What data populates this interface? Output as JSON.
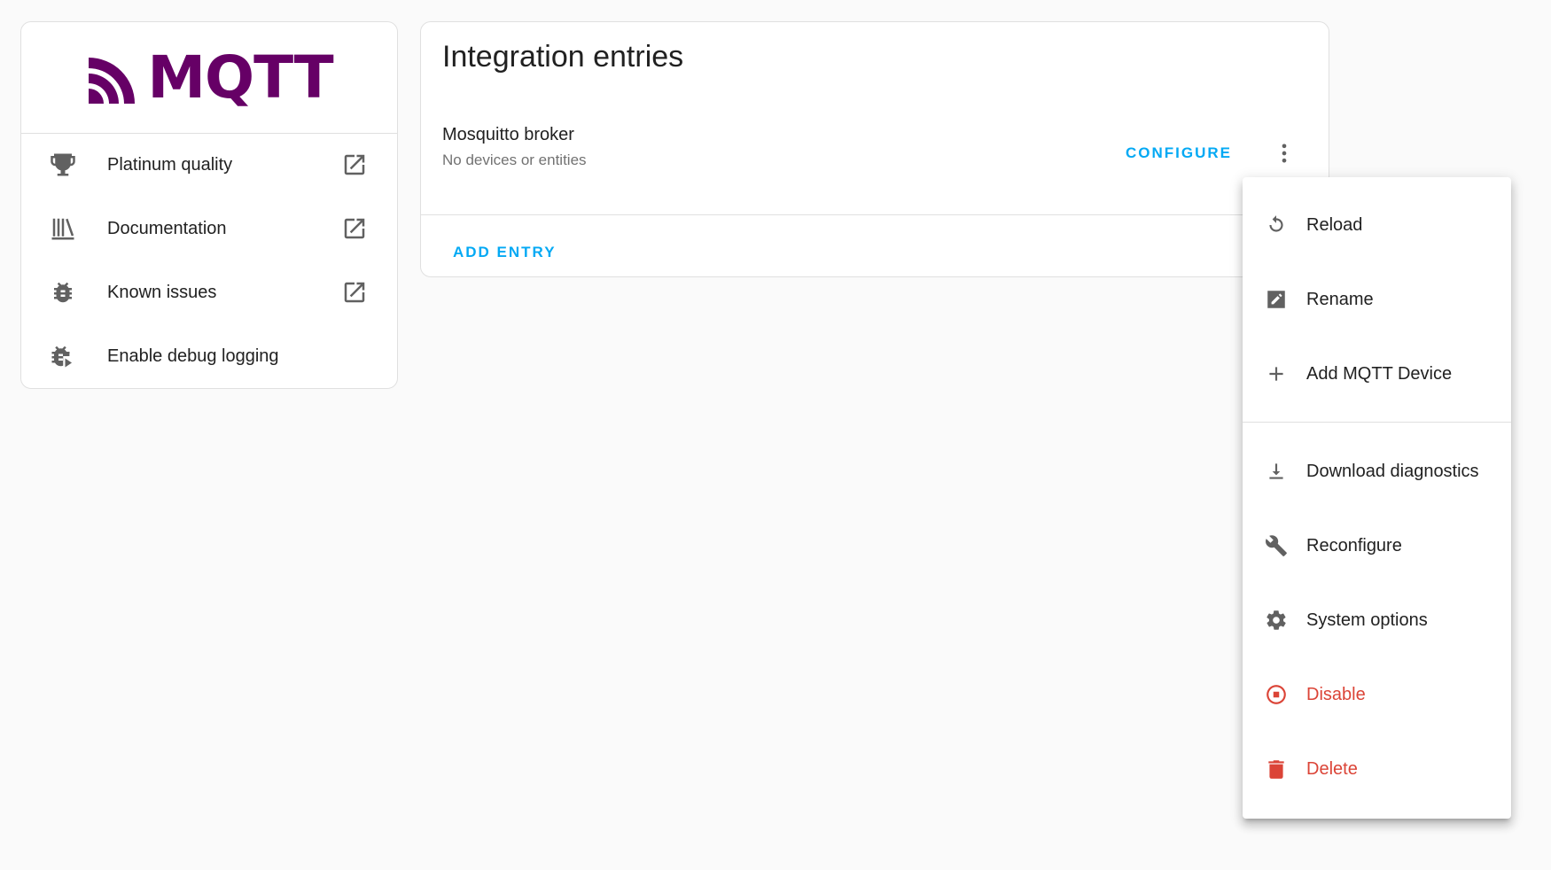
{
  "logo": {
    "text": "MQTT",
    "color": "#660066"
  },
  "info_links": [
    {
      "label": "Platinum quality",
      "icon": "trophy-icon",
      "external": true
    },
    {
      "label": "Documentation",
      "icon": "bookshelf-icon",
      "external": true
    },
    {
      "label": "Known issues",
      "icon": "bug-icon",
      "external": true
    },
    {
      "label": "Enable debug logging",
      "icon": "bug-play-icon",
      "external": false
    }
  ],
  "entries": {
    "title": "Integration entries",
    "items": [
      {
        "name": "Mosquitto broker",
        "subtitle": "No devices or entities",
        "configure_label": "CONFIGURE"
      }
    ],
    "add_entry_label": "ADD ENTRY"
  },
  "menu": {
    "items": [
      {
        "label": "Reload",
        "icon": "reload-icon"
      },
      {
        "label": "Rename",
        "icon": "rename-icon"
      },
      {
        "label": "Add MQTT Device",
        "icon": "plus-icon"
      },
      {
        "label": "Download diagnostics",
        "icon": "download-icon"
      },
      {
        "label": "Reconfigure",
        "icon": "wrench-icon"
      },
      {
        "label": "System options",
        "icon": "gear-icon"
      },
      {
        "label": "Disable",
        "icon": "stop-circle-icon",
        "danger": true
      },
      {
        "label": "Delete",
        "icon": "trash-icon",
        "danger": true
      }
    ]
  },
  "colors": {
    "accent": "#03a9f4",
    "danger": "#db4437",
    "icon": "#616161"
  }
}
